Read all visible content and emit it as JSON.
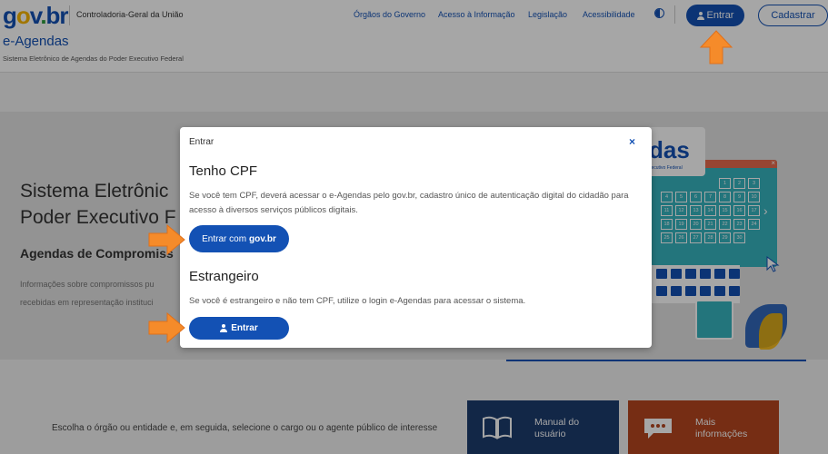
{
  "header": {
    "logo": {
      "g": "g",
      "o": "o",
      "v": "v",
      "dot": ".",
      "br": "br"
    },
    "org_name": "Controladoria-Geral da União",
    "nav": [
      "Órgãos do Governo",
      "Acesso à Informação",
      "Legislação",
      "Acessibilidade"
    ],
    "entrar_label": "Entrar",
    "cadastrar_label": "Cadastrar",
    "app_title": "e-Agendas",
    "app_subtitle": "Sistema Eletrônico de Agendas do Poder Executivo Federal"
  },
  "hero": {
    "title": "Sistema Eletrônic\nPoder Executivo F",
    "subtitle": "Agendas de Compromiss",
    "text": "Informações sobre compromissos pu\nrecebidas em representação instituci"
  },
  "illustration": {
    "title_big": "das",
    "title_small": "xecutivo Federal",
    "calendar_days": [
      "",
      "",
      "",
      "",
      "1",
      "2",
      "3",
      "4",
      "5",
      "6",
      "7",
      "8",
      "9",
      "10",
      "11",
      "12",
      "13",
      "14",
      "15",
      "16",
      "17",
      "18",
      "19",
      "20",
      "21",
      "22",
      "23",
      "24",
      "25",
      "26",
      "27",
      "28",
      "29",
      "30",
      ""
    ],
    "close_glyph": "×",
    "chevron": "›"
  },
  "bottom": {
    "text": "Escolha o órgão ou entidade e, em seguida, selecione o cargo ou o agente público de interesse",
    "card_manual": "Manual do\nusuário",
    "card_more": "Mais\ninformações"
  },
  "modal": {
    "header": "Entrar",
    "close": "×",
    "section1_title": "Tenho CPF",
    "section1_text": "Se você tem CPF, deverá acessar o e-Agendas pelo gov.br, cadastro único de autenticação digital do cidadão para acesso à diversos serviços públicos digitais.",
    "gov_button_prefix": "Entrar com",
    "gov_button_brand": "gov.br",
    "section2_title": "Estrangeiro",
    "section2_text": "Se você é estrangeiro e não tem CPF, utilize o login e-Agendas para acessar o sistema.",
    "entrar_button": "Entrar"
  },
  "colors": {
    "primary": "#1351b4",
    "arrow": "#f58b2a",
    "card_manual": "#1d3c6e",
    "card_more": "#b5451f"
  }
}
